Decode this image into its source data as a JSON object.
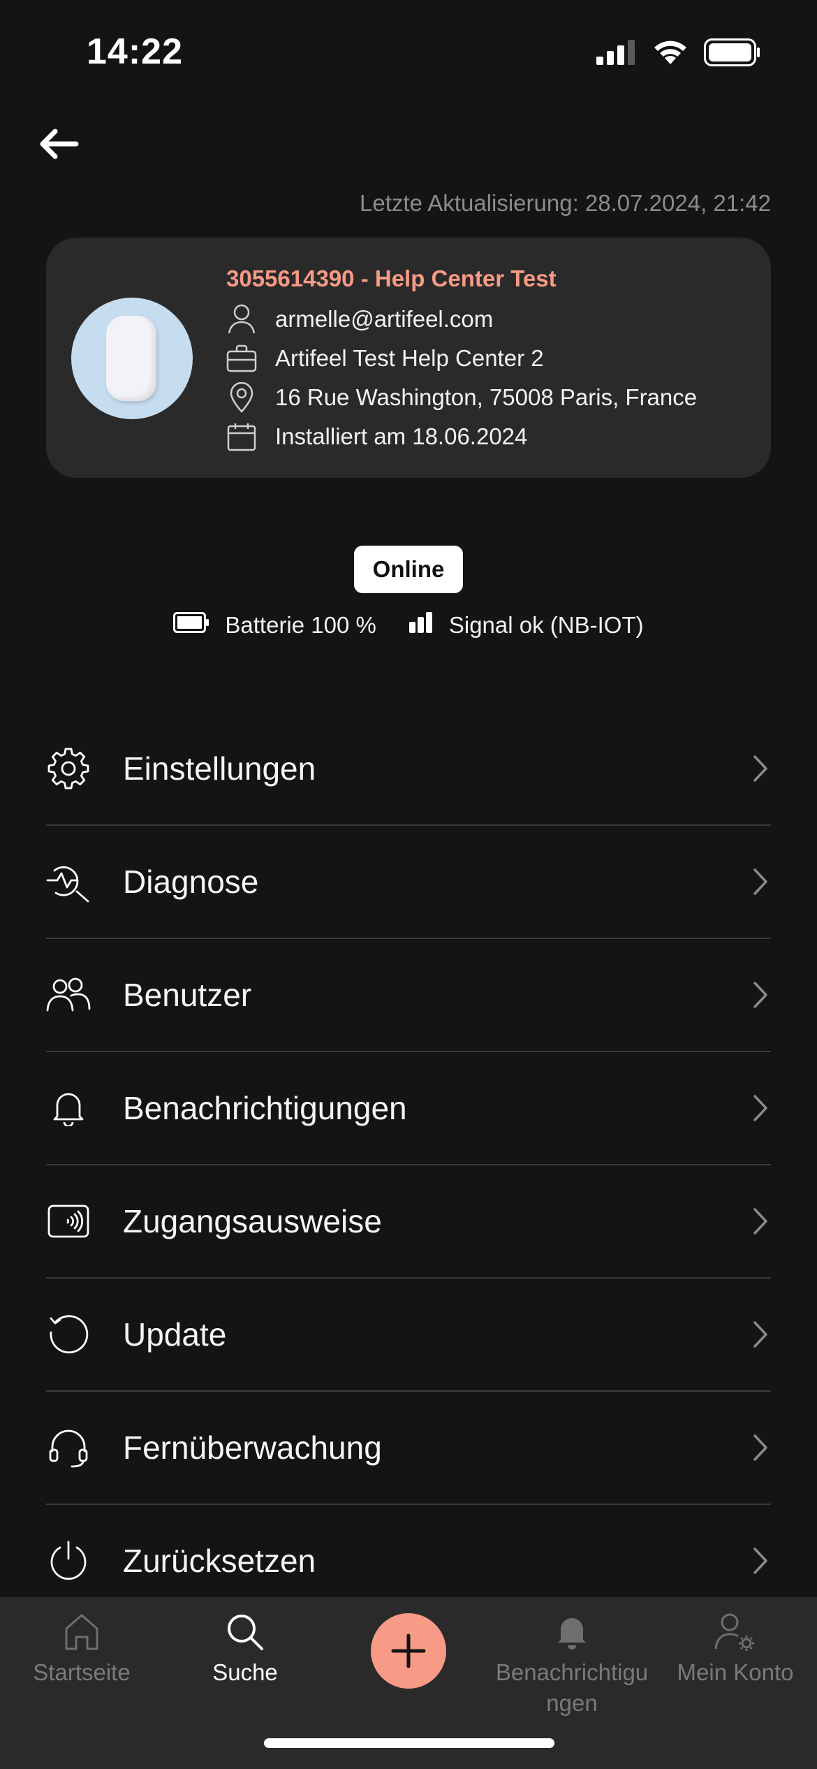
{
  "status_bar": {
    "time": "14:22"
  },
  "header": {
    "last_update": "Letzte Aktualisierung: 28.07.2024, 21:42"
  },
  "device": {
    "title": "3055614390 - Help Center Test",
    "email": "armelle@artifeel.com",
    "company": "Artifeel Test Help Center 2",
    "address": "16 Rue Washington, 75008 Paris, France",
    "installed": "Installiert am 18.06.2024"
  },
  "status": {
    "online": "Online",
    "battery": "Batterie 100 %",
    "signal": "Signal ok (NB-IOT)"
  },
  "menu": {
    "items": [
      {
        "label": "Einstellungen",
        "icon": "gear-icon"
      },
      {
        "label": "Diagnose",
        "icon": "diagnosis-icon"
      },
      {
        "label": "Benutzer",
        "icon": "users-icon"
      },
      {
        "label": "Benachrichtigungen",
        "icon": "bell-icon"
      },
      {
        "label": "Zugangsausweise",
        "icon": "access-card-icon"
      },
      {
        "label": "Update",
        "icon": "refresh-icon"
      },
      {
        "label": "Fernüberwachung",
        "icon": "headset-icon"
      },
      {
        "label": "Zurücksetzen",
        "icon": "power-icon"
      }
    ]
  },
  "bottom_nav": {
    "items": [
      {
        "label": "Startseite",
        "icon": "home-icon",
        "active": false
      },
      {
        "label": "Suche",
        "icon": "search-icon",
        "active": true
      },
      {
        "label": "Benachrichtigu\nngen",
        "icon": "bell-icon",
        "active": false
      },
      {
        "label": "Mein Konto",
        "icon": "account-settings-icon",
        "active": false
      }
    ],
    "fab_icon": "plus-icon"
  },
  "colors": {
    "background": "#141414",
    "card": "#2a2a2a",
    "accent": "#f79a86",
    "muted": "#7a7a7a"
  }
}
